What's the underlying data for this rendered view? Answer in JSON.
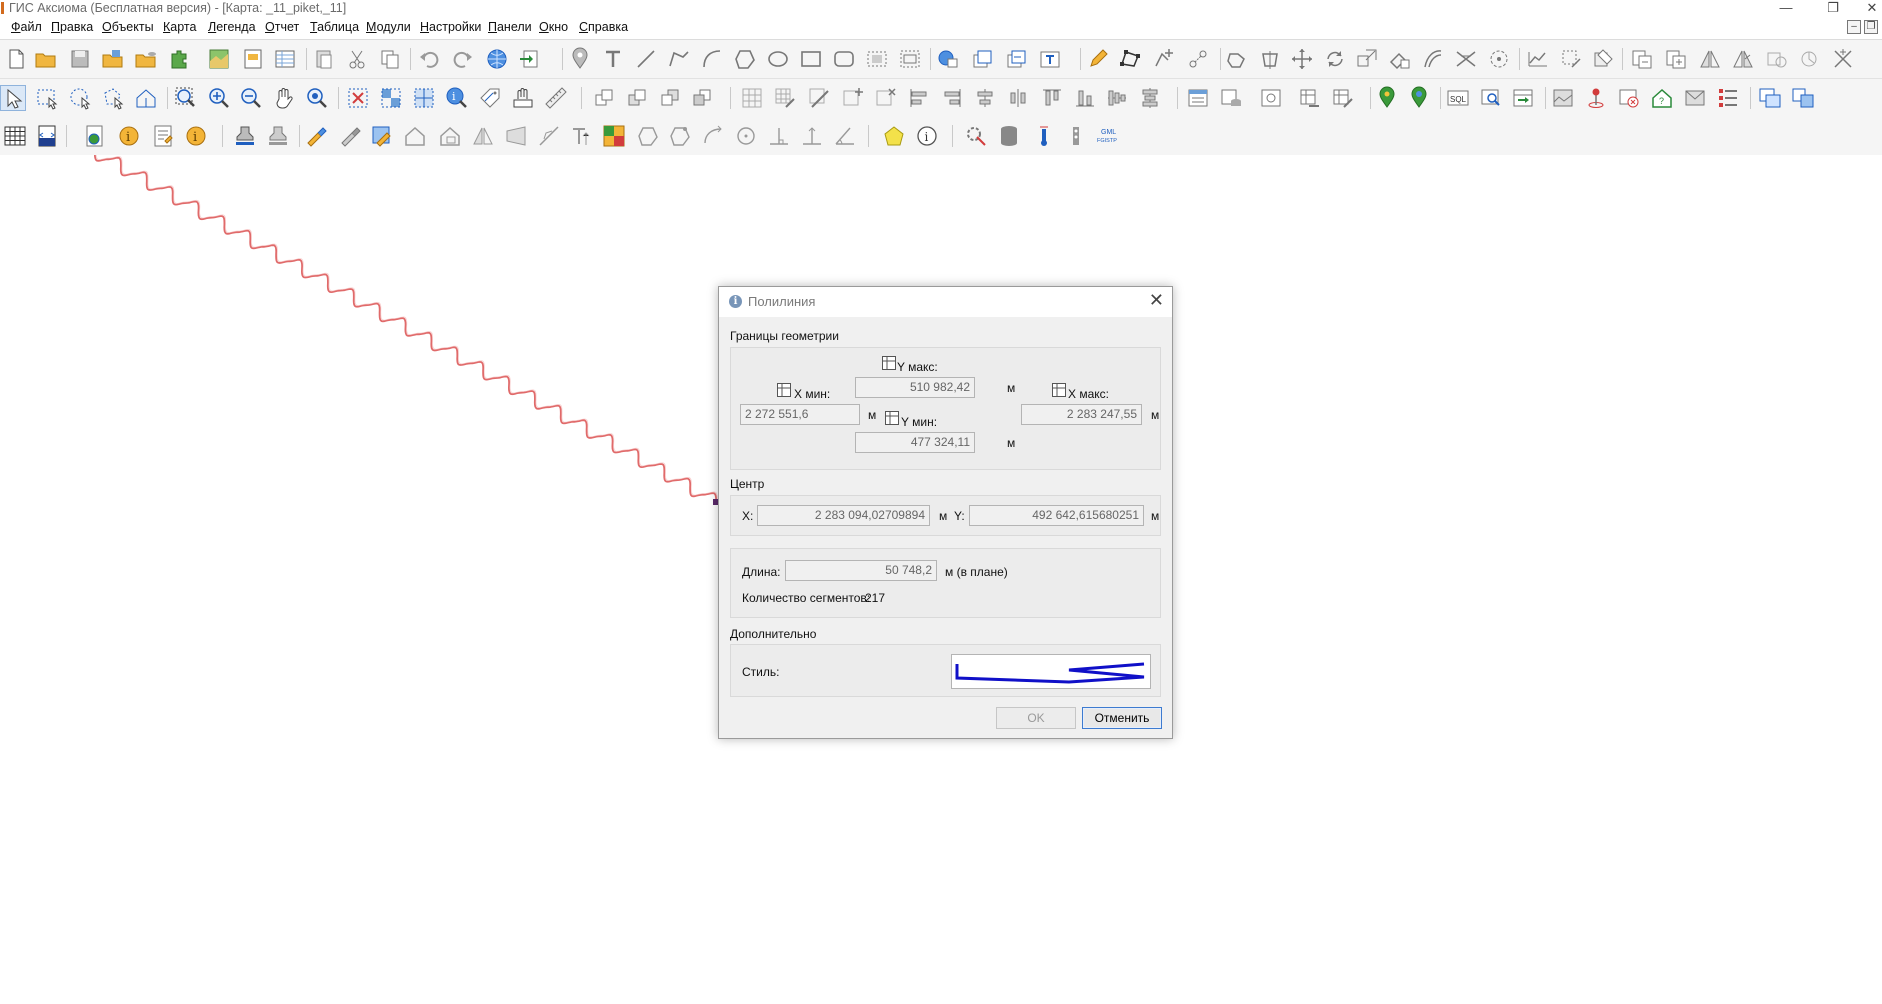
{
  "window": {
    "title": "ГИС Аксиома (Бесплатная версия) - [Карта: _11_piket,_11]",
    "controls": [
      "—",
      "❐",
      "✕"
    ]
  },
  "menu": [
    {
      "label": "Файл"
    },
    {
      "label": "Правка"
    },
    {
      "label": "Объекты"
    },
    {
      "label": "Карта"
    },
    {
      "label": "Легенда"
    },
    {
      "label": "Отчет"
    },
    {
      "label": "Таблица"
    },
    {
      "label": "Модули"
    },
    {
      "label": "Настройки"
    },
    {
      "label": "Панели"
    },
    {
      "label": "Окно"
    },
    {
      "label": "Справка"
    }
  ],
  "mdi_controls": [
    "–",
    "❐"
  ],
  "toolbar_row3": {
    "sql_label": "SQL",
    "gml_label": "GML\nFGISTP"
  },
  "map": {
    "polyline_color": "#e06a6a",
    "selection_marker_color": "#5a2a6a"
  },
  "dialog": {
    "title": "Полилиния",
    "title_icon": "info-icon",
    "sections": {
      "bounds": "Границы геометрии",
      "center": "Центр",
      "extra": "Дополнительно"
    },
    "bounds": {
      "x_min_label": "X мин:",
      "x_min_value": "2 272 551,6",
      "x_max_label": "X макс:",
      "x_max_value": "2 283 247,55",
      "y_max_label": "Y макс:",
      "y_max_value": "510 982,42",
      "y_min_label": "Y мин:",
      "y_min_value": "477 324,11",
      "unit": "м"
    },
    "center": {
      "x_label": "X:",
      "x_value": "2 283 094,02709894",
      "y_label": "Y:",
      "y_value": "492 642,615680251",
      "unit": "м"
    },
    "length": {
      "label": "Длина:",
      "value": "50 748,2",
      "unit": "м (в плане)"
    },
    "segments": {
      "label": "Количество сегментов:",
      "value": "217"
    },
    "style": {
      "label": "Стиль:",
      "preview_color": "#1010c8"
    },
    "buttons": {
      "ok": "OK",
      "cancel": "Отменить"
    }
  },
  "colors": {
    "accent_blue": "#1f5fbf",
    "toolbar_bg": "#f5f5f5",
    "dialog_bg": "#f0f0f0"
  }
}
